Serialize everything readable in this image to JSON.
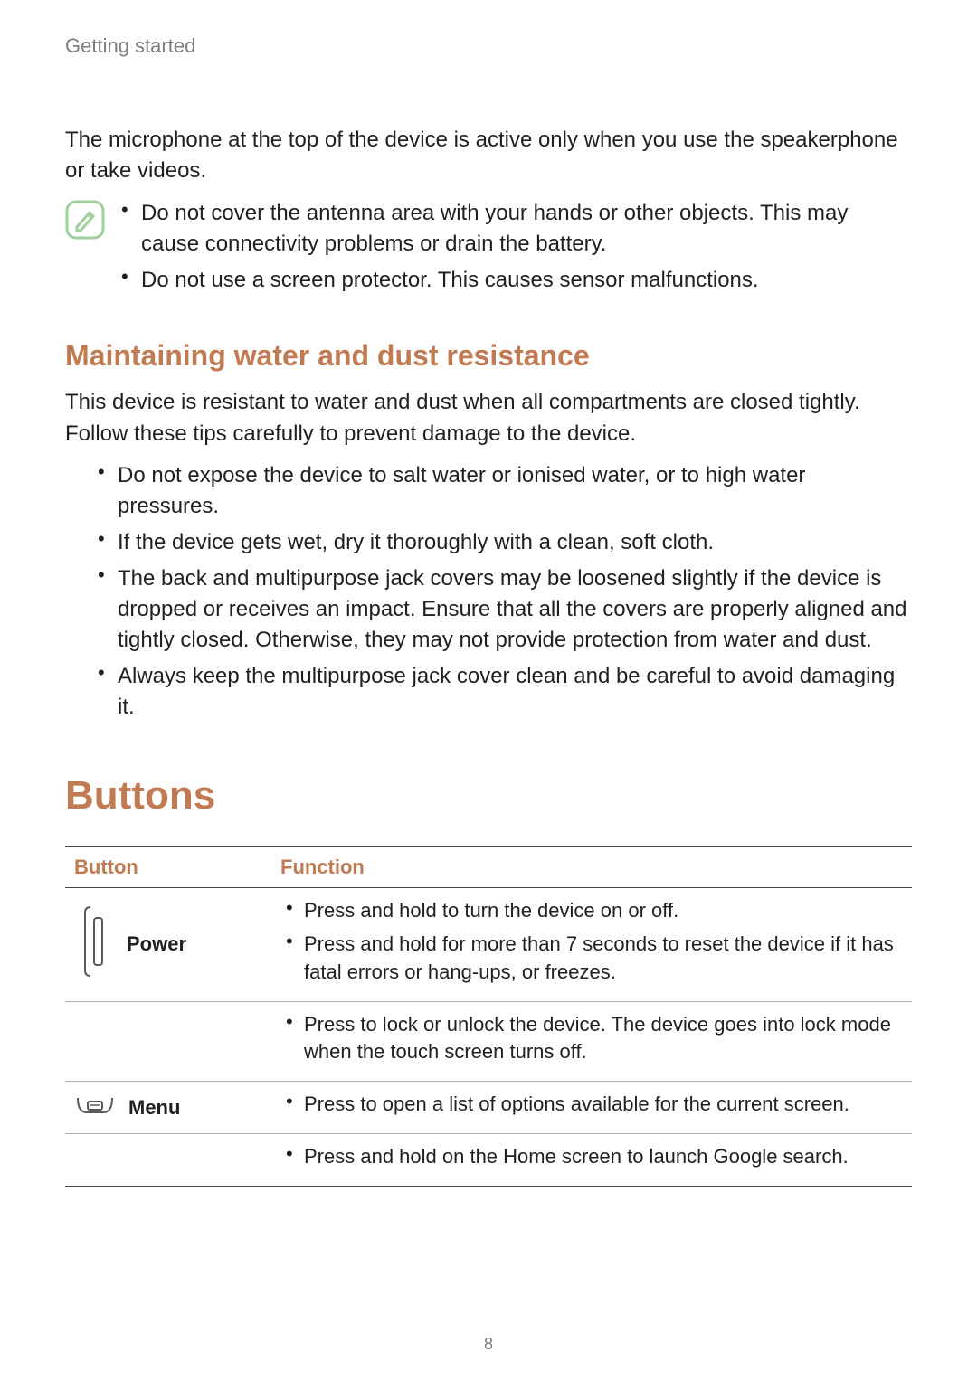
{
  "page": {
    "breadcrumb": "Getting started",
    "page_number": "8"
  },
  "intro": {
    "text": "The microphone at the top of the device is active only when you use the speakerphone or take videos."
  },
  "note": {
    "icon_name": "note-pencil-icon",
    "items": [
      "Do not cover the antenna area with your hands or other objects. This may cause connectivity problems or drain the battery.",
      "Do not use a screen protector. This causes sensor malfunctions."
    ]
  },
  "section_water": {
    "title": "Maintaining water and dust resistance",
    "intro": "This device is resistant to water and dust when all compartments are closed tightly. Follow these tips carefully to prevent damage to the device.",
    "tips": [
      "Do not expose the device to salt water or ionised water, or to high water pressures.",
      "If the device gets wet, dry it thoroughly with a clean, soft cloth.",
      "The back and multipurpose jack covers may be loosened slightly if the device is dropped or receives an impact. Ensure that all the covers are properly aligned and tightly closed. Otherwise, they may not provide protection from water and dust.",
      "Always keep the multipurpose jack cover clean and be careful to avoid damaging it."
    ]
  },
  "section_buttons": {
    "title": "Buttons",
    "headers": {
      "button": "Button",
      "function": "Function"
    },
    "rows": [
      {
        "icon_name": "power-button-icon",
        "label": "Power",
        "functions": [
          "Press and hold to turn the device on or off.",
          "Press and hold for more than 7 seconds to reset the device if it has fatal errors or hang-ups, or freezes.",
          "Press to lock or unlock the device. The device goes into lock mode when the touch screen turns off."
        ]
      },
      {
        "icon_name": "menu-button-icon",
        "label": "Menu",
        "functions": [
          "Press to open a list of options available for the current screen.",
          "Press and hold on the Home screen to launch Google search."
        ]
      }
    ]
  }
}
